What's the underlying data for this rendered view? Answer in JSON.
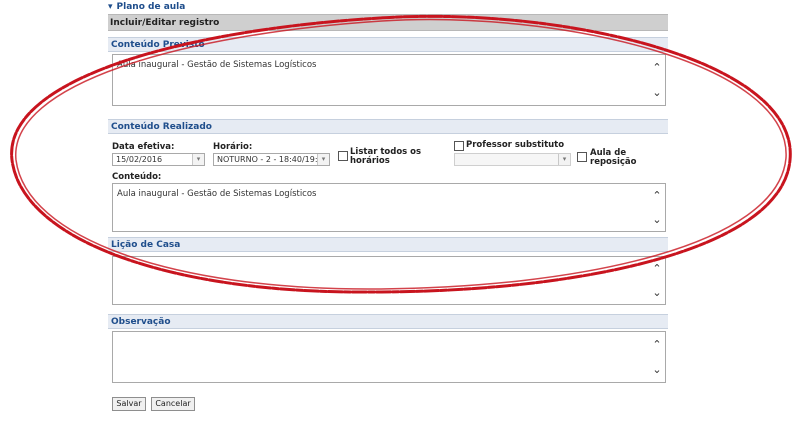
{
  "panel": {
    "title": "Plano de aula",
    "form_header": "Incluir/Editar registro"
  },
  "conteudo_previsto": {
    "heading": "Conteúdo Previsto",
    "text": "Aula inaugural - Gestão de Sistemas Logísticos"
  },
  "conteudo_realizado": {
    "heading": "Conteúdo Realizado",
    "data_label": "Data efetiva:",
    "data_value": "15/02/2016",
    "horario_label": "Horário:",
    "horario_value": "NOTURNO - 2 - 18:40/19:3",
    "listar_label_1": "Listar todos os",
    "listar_label_2": "horários",
    "professor_label": "Professor substituto",
    "professor_value": "",
    "reposicao_label_1": "Aula de",
    "reposicao_label_2": "reposição",
    "conteudo_label": "Conteúdo:",
    "conteudo_text": "Aula inaugural - Gestão de Sistemas Logísticos"
  },
  "licao_de_casa": {
    "heading": "Lição de Casa",
    "text": ""
  },
  "observacao": {
    "heading": "Observação",
    "text": ""
  },
  "buttons": {
    "salvar": "Salvar",
    "cancelar": "Cancelar"
  },
  "icons": {
    "scroll_up": "chevron-up-icon",
    "scroll_down": "chevron-down-icon",
    "dropdown": "dropdown-arrow-icon",
    "collapse": "collapse-triangle-icon"
  },
  "colors": {
    "annotation_ellipse": "#c8141e",
    "section_text": "#1f4e8c",
    "section_bg": "#e6ebf3",
    "header_bg": "#cfcfcf"
  }
}
